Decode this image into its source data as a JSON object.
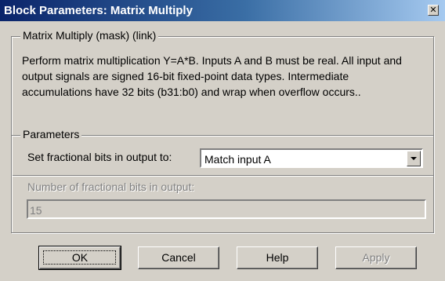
{
  "window": {
    "title": "Block Parameters: Matrix Multiply",
    "close_glyph": "✕"
  },
  "mask_group": {
    "legend": "Matrix Multiply (mask) (link)",
    "description": "Perform matrix multiplication Y=A*B. Inputs A and B must be real. All input and output signals are signed 16-bit fixed-point data types. Intermediate accumulations have 32 bits (b31:b0) and wrap when overflow occurs.."
  },
  "parameters": {
    "legend": "Parameters",
    "fractional_bits_label": "Set fractional bits in output to:",
    "fractional_bits_value": "Match input A",
    "num_fractional_label": "Number of fractional bits in output:",
    "num_fractional_value": "15"
  },
  "buttons": {
    "ok": "OK",
    "cancel": "Cancel",
    "help": "Help",
    "apply": "Apply"
  },
  "icons": {
    "close": "close-icon",
    "dropdown": "chevron-down-icon"
  }
}
